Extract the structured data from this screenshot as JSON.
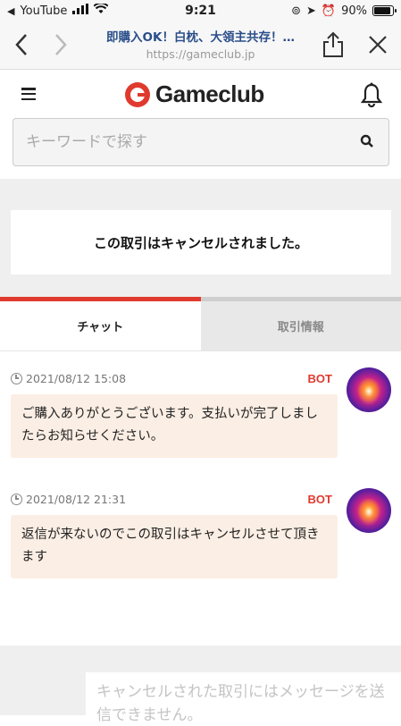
{
  "status_bar": {
    "back_app": "YouTube",
    "time": "9:21",
    "battery": "90%",
    "battery_level": 0.9
  },
  "browser": {
    "page_title": "即購入OK！白枕、大領主共存！…",
    "url": "https://gameclub.jp"
  },
  "header": {
    "logo_text": "Gameclub",
    "search_placeholder": "キーワードで探す"
  },
  "notice": "この取引はキャンセルされました。",
  "tabs": [
    {
      "label": "チャット"
    },
    {
      "label": "取引情報"
    }
  ],
  "messages": [
    {
      "timestamp": "2021/08/12 15:08",
      "sender": "BOT",
      "text": "ご購入ありがとうございます。支払いが完了しましたらお知らせください。"
    },
    {
      "timestamp": "2021/08/12 21:31",
      "sender": "BOT",
      "text": "返信が来ないのでこの取引はキャンセルさせて頂きます"
    }
  ],
  "composer": {
    "disabled_text": "キャンセルされた取引にはメッセージを送信できません。"
  },
  "colors": {
    "accent": "#e03a2f",
    "bubble": "#fbeee4",
    "link": "#2a4e8a"
  }
}
